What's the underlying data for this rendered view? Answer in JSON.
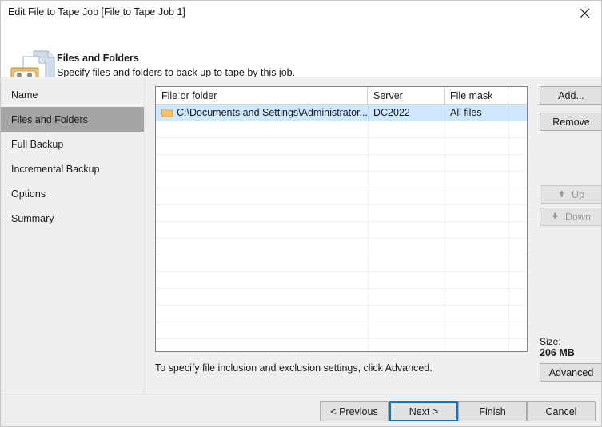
{
  "window": {
    "title": "Edit File to Tape Job [File to Tape Job 1]",
    "close_icon": "close-icon"
  },
  "header": {
    "icon": "tape-and-files-icon",
    "title": "Files and Folders",
    "subtitle": "Specify files and folders to back up to tape by this job."
  },
  "sidebar": {
    "items": [
      {
        "label": "Name",
        "selected": false
      },
      {
        "label": "Files and Folders",
        "selected": true
      },
      {
        "label": "Full Backup",
        "selected": false
      },
      {
        "label": "Incremental Backup",
        "selected": false
      },
      {
        "label": "Options",
        "selected": false
      },
      {
        "label": "Summary",
        "selected": false
      }
    ]
  },
  "grid": {
    "columns": [
      "File or folder",
      "Server",
      "File mask"
    ],
    "rows": [
      {
        "icon": "folder-icon",
        "file_or_folder": "C:\\Documents and Settings\\Administrator...",
        "server": "DC2022",
        "file_mask": "All files"
      }
    ],
    "empty_row_count": 13
  },
  "side_buttons": {
    "add": {
      "label": "Add...",
      "enabled": true
    },
    "remove": {
      "label": "Remove",
      "enabled": true
    },
    "up": {
      "label": "Up",
      "icon": "arrow-up-icon",
      "enabled": false
    },
    "down": {
      "label": "Down",
      "icon": "arrow-down-icon",
      "enabled": false
    },
    "advanced": {
      "label": "Advanced",
      "enabled": true
    }
  },
  "size": {
    "label": "Size:",
    "value": "206 MB"
  },
  "hint": "To specify file inclusion and exclusion settings, click Advanced.",
  "footer": {
    "previous": "< Previous",
    "next": "Next >",
    "finish": "Finish",
    "cancel": "Cancel",
    "focus_accent": "#0078d7"
  }
}
